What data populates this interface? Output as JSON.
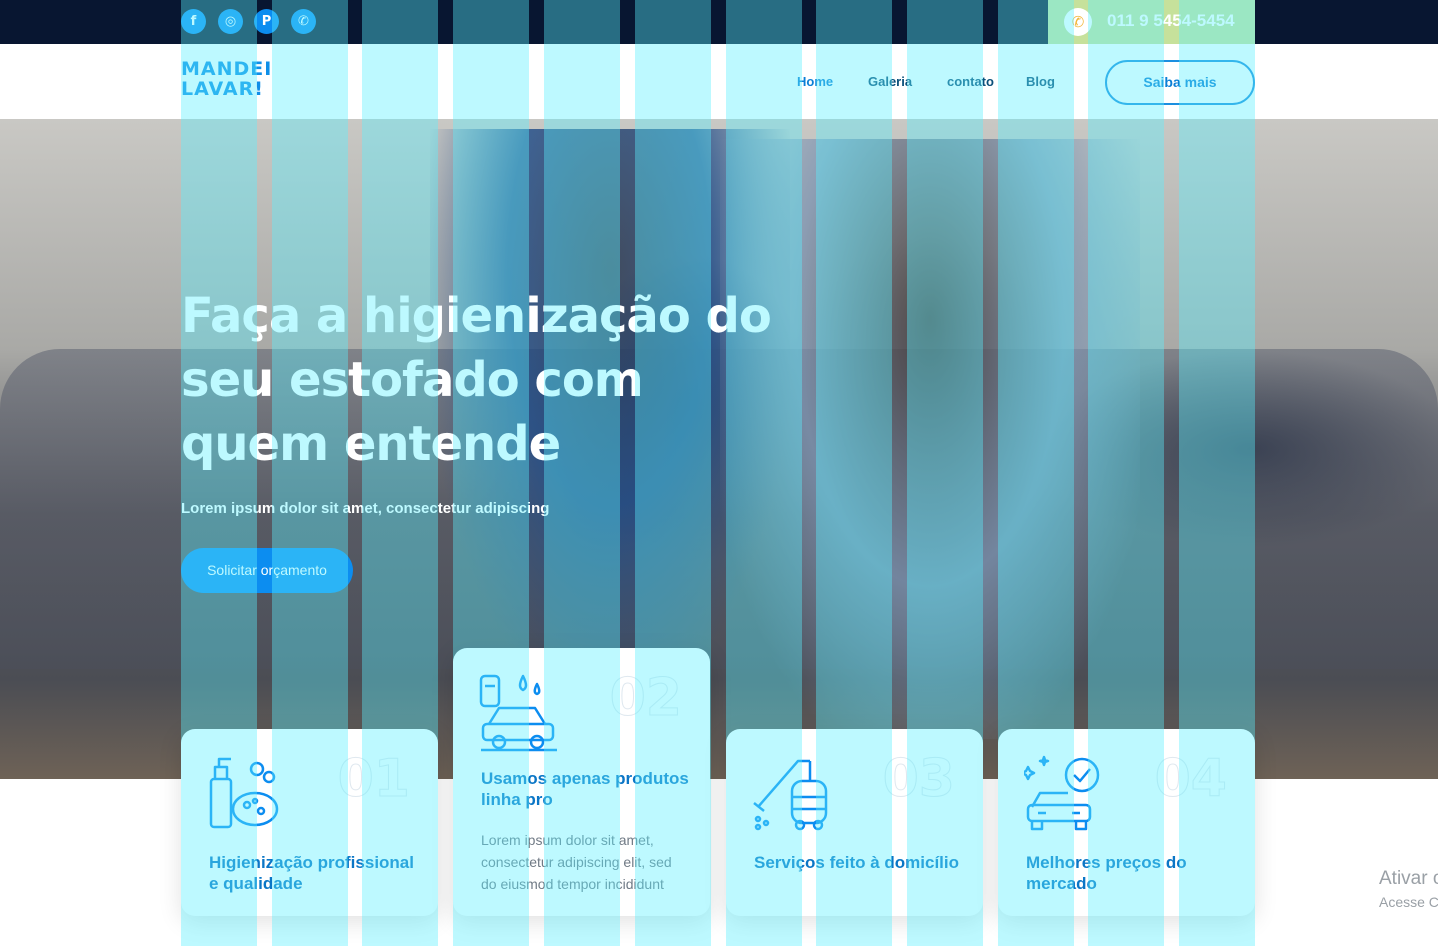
{
  "topbar": {
    "social_icons": [
      {
        "name": "facebook-icon",
        "glyph": "f"
      },
      {
        "name": "instagram-icon",
        "glyph": "◎"
      },
      {
        "name": "pinterest-icon",
        "glyph": "P"
      },
      {
        "name": "phone-icon",
        "glyph": "✆"
      }
    ],
    "phone_number": "011 9 5454-5454",
    "colors": {
      "bar": "#081631",
      "phone_bg": "#c6e19b",
      "accent": "#0c8df0"
    }
  },
  "nav": {
    "logo_line1": "MANDEI",
    "logo_line2": "LAVAR!",
    "links": [
      "Home",
      "Galeria",
      "contato",
      "Blog"
    ],
    "active": "Home",
    "cta": "Saiba mais"
  },
  "hero": {
    "title": "Faça a higienização do seu estofado com quem entende",
    "subtitle": "Lorem ipsum dolor sit amet, consectetur adipiscing",
    "button": "Solicitar orçamento"
  },
  "cards": [
    {
      "number": "01",
      "icon": "cleaning-products-icon",
      "title": "Higienização profissional e qualidade",
      "text": ""
    },
    {
      "number": "02",
      "icon": "car-wash-icon",
      "title": "Usamos apenas produtos linha pro",
      "text": "Lorem ipsum dolor sit amet, consectetur adipiscing elit, sed do eiusmod tempor incididunt"
    },
    {
      "number": "03",
      "icon": "vacuum-cleaner-icon",
      "title": "Serviços feito à domicílio",
      "text": ""
    },
    {
      "number": "04",
      "icon": "car-check-icon",
      "title": "Melhores preços do mercado",
      "text": ""
    }
  ],
  "watermark": {
    "line1": "Ativar o",
    "line2": "Acesse C"
  }
}
